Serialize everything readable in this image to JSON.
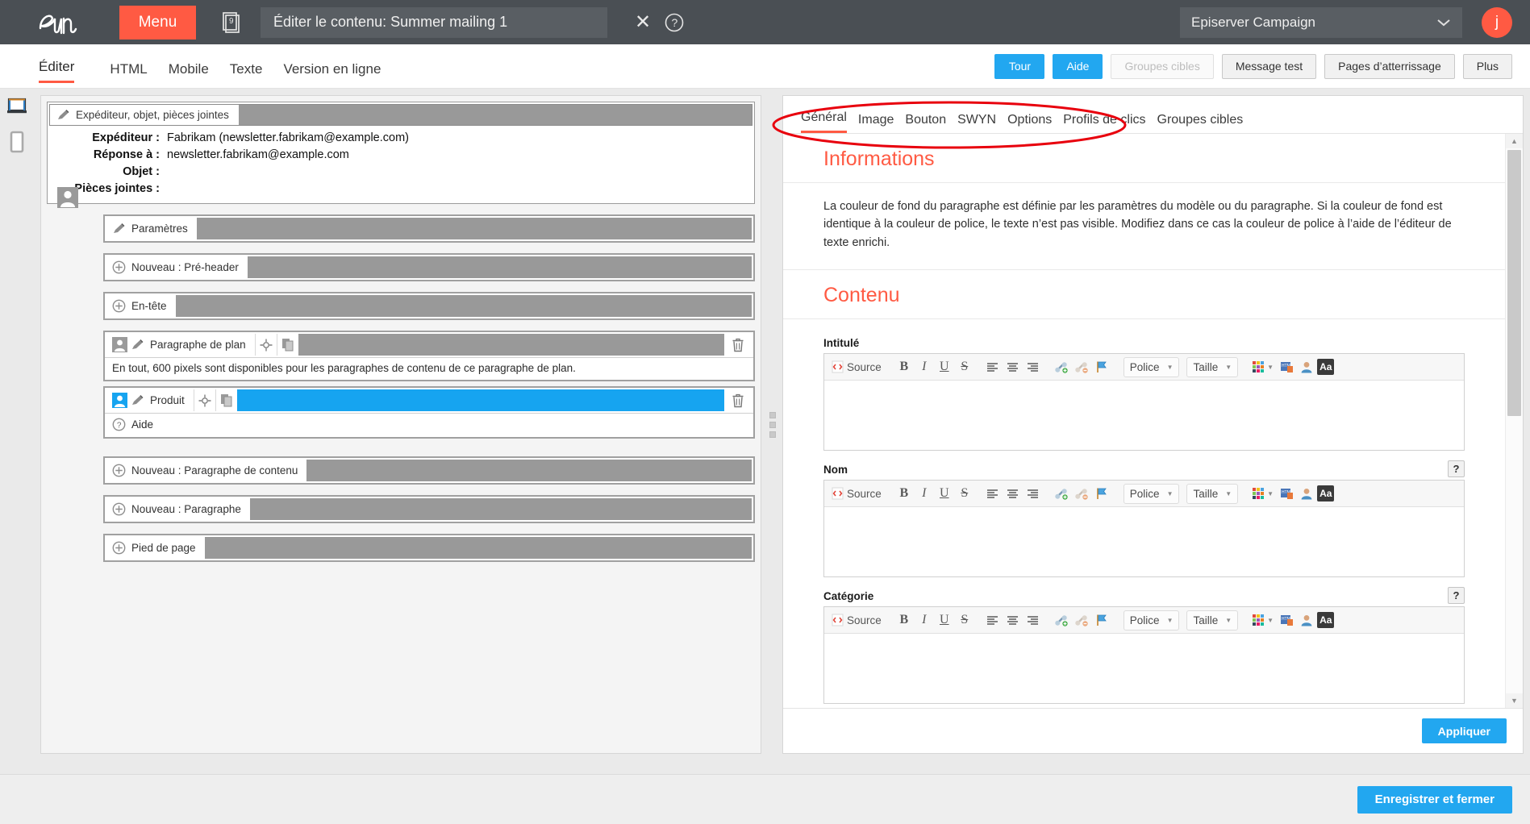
{
  "topbar": {
    "logo_alt": "Episerver logo",
    "menu_label": "Menu",
    "doc_count": "9",
    "window_title": "Éditer le contenu: Summer mailing 1",
    "close_label": "✕",
    "client_name": "Episerver Campaign",
    "user_initial": "j"
  },
  "view_tabs": [
    {
      "label": "Éditer",
      "active": true
    },
    {
      "label": "HTML",
      "active": false
    },
    {
      "label": "Mobile",
      "active": false
    },
    {
      "label": "Texte",
      "active": false
    },
    {
      "label": "Version en ligne",
      "active": false
    }
  ],
  "action_buttons": [
    {
      "label": "Tour",
      "style": "primary"
    },
    {
      "label": "Aide",
      "style": "primary"
    },
    {
      "label": "Groupes cibles",
      "style": "disabled"
    },
    {
      "label": "Message test",
      "style": "normal"
    },
    {
      "label": "Pages d’atterrissage",
      "style": "normal"
    },
    {
      "label": "Plus",
      "style": "normal"
    }
  ],
  "rail": {
    "desktop_icon": "desktop-icon",
    "mobile_icon": "mobile-icon"
  },
  "preview": {
    "header_strip_label": "Expéditeur, objet, pièces jointes",
    "fields": [
      {
        "key": "Expéditeur :",
        "value": "Fabrikam (newsletter.fabrikam@example.com)"
      },
      {
        "key": "Réponse à :",
        "value": "newsletter.fabrikam@example.com"
      },
      {
        "key": "Objet :",
        "value": ""
      },
      {
        "key": "Pièces jointes :",
        "value": ""
      }
    ],
    "blocks": [
      {
        "type": "edit",
        "label": "Paramètres",
        "body": null,
        "selected": false
      },
      {
        "type": "new",
        "label": "Nouveau : Pré-header",
        "body": null,
        "selected": false
      },
      {
        "type": "new",
        "label": "En-tête",
        "body": null,
        "selected": false
      },
      {
        "type": "content",
        "label": "Paragraphe de plan",
        "body": "En tout, 600 pixels sont disponibles pour les paragraphes de contenu de ce paragraphe de plan.",
        "selected": false
      },
      {
        "type": "content",
        "label": "Produit",
        "body": "Aide",
        "selected": true
      },
      {
        "type": "new",
        "label": "Nouveau : Paragraphe de contenu",
        "body": null,
        "selected": false
      },
      {
        "type": "new",
        "label": "Nouveau : Paragraphe",
        "body": null,
        "selected": false
      },
      {
        "type": "new",
        "label": "Pied de page",
        "body": null,
        "selected": false
      }
    ]
  },
  "props": {
    "tabs": [
      {
        "label": "Général",
        "active": true
      },
      {
        "label": "Image",
        "active": false
      },
      {
        "label": "Bouton",
        "active": false
      },
      {
        "label": "SWYN",
        "active": false
      },
      {
        "label": "Options",
        "active": false
      },
      {
        "label": "Profils de clics",
        "active": false
      },
      {
        "label": "Groupes cibles",
        "active": false
      }
    ],
    "info_title": "Informations",
    "info_text": "La couleur de fond du paragraphe est définie par les paramètres du modèle ou du paragraphe. Si la couleur de fond est identique à la couleur de police, le texte n’est pas visible. Modifiez dans ce cas la couleur de police à l’aide de l’éditeur de texte enrichi.",
    "content_title": "Contenu",
    "fields": [
      {
        "label": "Intitulé",
        "value": "",
        "help": null
      },
      {
        "label": "Nom",
        "value": "",
        "help": "?"
      },
      {
        "label": "Catégorie",
        "value": "",
        "help": "?"
      }
    ],
    "rte_toolbar": {
      "source_label": "Source",
      "bold": "B",
      "italic": "I",
      "underline": "U",
      "strike": "S",
      "align_left": "align-left-icon",
      "align_center": "align-center-icon",
      "align_right": "align-right-icon",
      "link": "link-add-icon",
      "unlink": "link-remove-icon",
      "anchor": "anchor-flag-icon",
      "font_label": "Police",
      "size_label": "Taille",
      "colors": "color-palette-icon",
      "html_snippet": "html-snippet-icon",
      "personalize": "personalization-icon",
      "text_case": "Aa"
    },
    "apply_label": "Appliquer"
  },
  "bottom": {
    "save_close_label": "Enregistrer et fermer"
  },
  "colors": {
    "brand_orange": "#ff5a43",
    "accent_blue": "#22a7f0",
    "selection_blue": "#16a4f0",
    "topbar_dark": "#4a4f54",
    "annotation_red": "#e8000d"
  }
}
